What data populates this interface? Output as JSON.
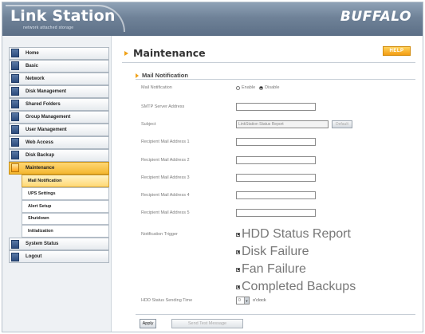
{
  "header": {
    "logo": "Link Station",
    "logo_subtitle": "network attached storage",
    "brand": "BUFFALO"
  },
  "sidebar": {
    "items": [
      {
        "label": "Home"
      },
      {
        "label": "Basic"
      },
      {
        "label": "Network"
      },
      {
        "label": "Disk Management"
      },
      {
        "label": "Shared Folders"
      },
      {
        "label": "Group Management"
      },
      {
        "label": "User Management"
      },
      {
        "label": "Web Access"
      },
      {
        "label": "Disk Backup"
      },
      {
        "label": "Maintenance"
      },
      {
        "label": "System Status"
      },
      {
        "label": "Logout"
      }
    ],
    "subitems": [
      {
        "label": "Mail Notification"
      },
      {
        "label": "UPS Settings"
      },
      {
        "label": "Alert Setup"
      },
      {
        "label": "Shutdown"
      },
      {
        "label": "Initialization"
      }
    ]
  },
  "main": {
    "title": "Maintenance",
    "help_label": "HELP",
    "section_title": "Mail Notification",
    "form": {
      "mail_notification": {
        "label": "Mail Notification",
        "enable": "Enable",
        "disable": "Disable",
        "selected": "Disable"
      },
      "smtp": {
        "label": "SMTP Server Address",
        "value": ""
      },
      "subject": {
        "label": "Subject",
        "value": "LinkStation Status Report",
        "default_button": "Default"
      },
      "recipients": [
        {
          "label": "Recipient Mail Address 1",
          "value": ""
        },
        {
          "label": "Recipient Mail Address 2",
          "value": ""
        },
        {
          "label": "Recipient Mail Address 3",
          "value": ""
        },
        {
          "label": "Recipient Mail Address 4",
          "value": ""
        },
        {
          "label": "Recipient Mail Address 5",
          "value": ""
        }
      ],
      "trigger": {
        "label": "Notification Trigger",
        "options": [
          {
            "label": "HDD Status Report",
            "checked": true
          },
          {
            "label": "Disk Failure",
            "checked": true
          },
          {
            "label": "Fan Failure",
            "checked": true
          },
          {
            "label": "Completed Backups",
            "checked": true
          }
        ]
      },
      "sending_time": {
        "label": "HDD Status Sending Time",
        "value": "0",
        "suffix": "o'clock"
      }
    },
    "apply_label": "Apply",
    "test_label": "Send Test Message"
  },
  "colors": {
    "accent": "#f0a21a",
    "header": "#6f8298",
    "nav_icon": "#2c4b7d"
  }
}
